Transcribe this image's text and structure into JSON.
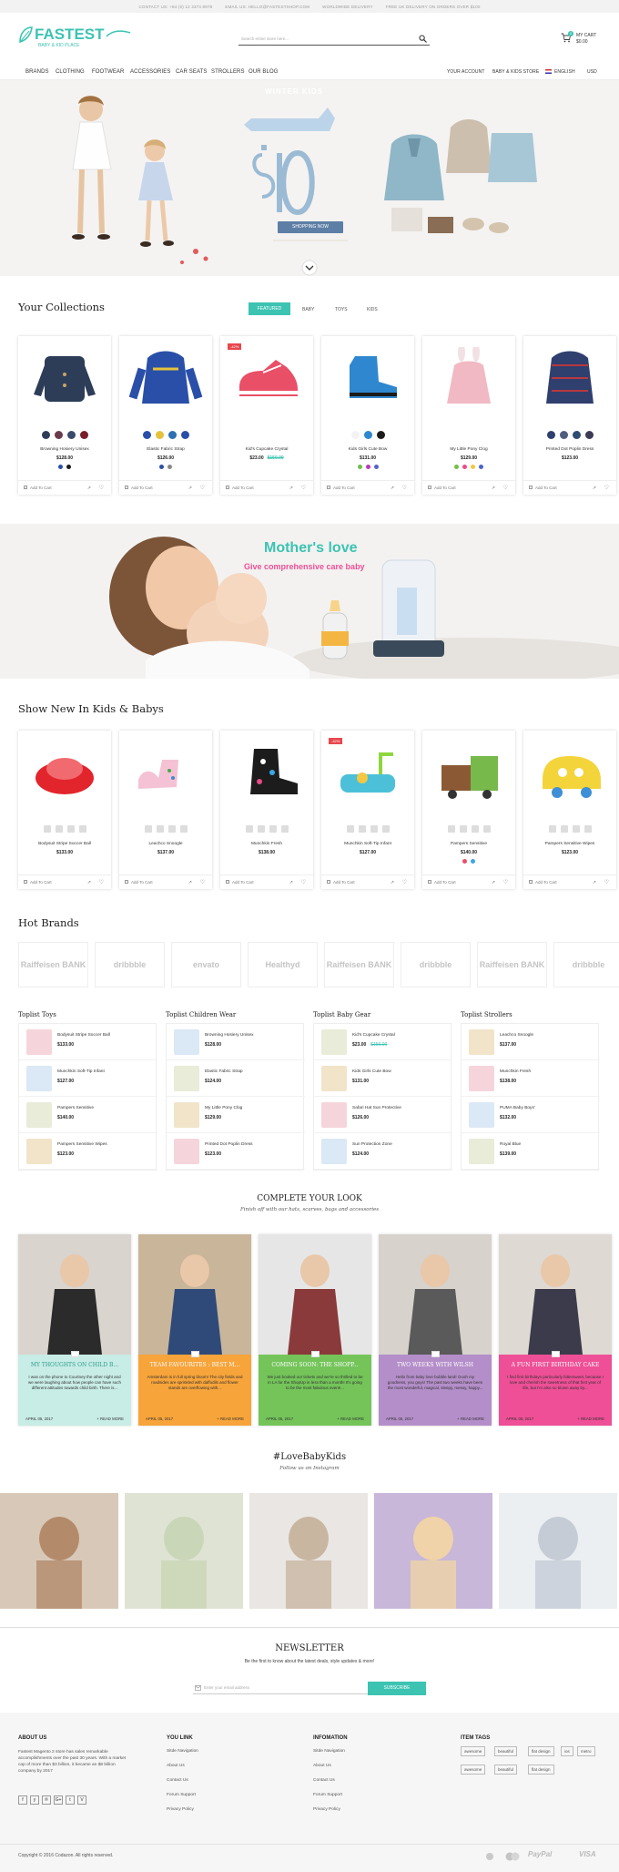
{
  "topbar": {
    "contact": "CONTACT US: +84 (0) 12 3374 8978",
    "email": "EMAIL US: HELLO@FASTESTSHOP.COM",
    "worldwide": "WORLDWIDE DELIVERY",
    "delivery": "FREE UK DELIVERY ON ORDERS OVER $100"
  },
  "header": {
    "logo_text": "FASTEST",
    "logo_sub": "BABY & KID PLACE",
    "search_placeholder": "Search entire store here...",
    "cart_label": "MY CART",
    "cart_total": "$0.00",
    "cart_count": "0"
  },
  "nav": {
    "items": [
      "BRANDS",
      "CLOTHING",
      "FOOTWEAR",
      "ACCESSORIES",
      "CAR SEATS",
      "STROLLERS",
      "OUR BLOG"
    ],
    "account": "YOUR ACCOUNT",
    "store": "BABY & KIDS STORE",
    "language": "ENGLISH",
    "currency": "USD"
  },
  "hero": {
    "badge": "WINTER KIDS",
    "price": "$10",
    "button": "SHOPPING NOW"
  },
  "collections": {
    "title": "Your Collections",
    "tabs": [
      "FEATURED",
      "BABY",
      "TOYS",
      "KIDS"
    ],
    "add_to_cart": "Add To Cart",
    "products": [
      {
        "name": "Browning Hosiery Unisex",
        "price": "$128.00",
        "old_price": "",
        "badge": ""
      },
      {
        "name": "Elastic Fabric Strap",
        "price": "$126.00",
        "old_price": "",
        "badge": ""
      },
      {
        "name": "Kid's Cupcake Crystal",
        "price": "$23.00",
        "old_price": "$150.00",
        "badge": "-42%"
      },
      {
        "name": "Kids Girls Cute Bow",
        "price": "$131.00",
        "old_price": "",
        "badge": ""
      },
      {
        "name": "My Little Pony Clog",
        "price": "$129.00",
        "old_price": "",
        "badge": ""
      },
      {
        "name": "Printed Dot Poplin Dress",
        "price": "$123.00",
        "old_price": "",
        "badge": ""
      }
    ]
  },
  "banner": {
    "title": "Mother's love",
    "subtitle": "Give comprehensive care baby"
  },
  "new_in": {
    "title": "Show New In Kids & Babys",
    "products": [
      {
        "name": "Bodysuit Stripe Soccer Ball",
        "price": "$133.00",
        "badge": ""
      },
      {
        "name": "Leachco Snoogle",
        "price": "$137.00",
        "badge": ""
      },
      {
        "name": "Munchkin Fresh",
        "price": "$138.00",
        "badge": ""
      },
      {
        "name": "Munchkin Soft-Tip Infant",
        "price": "$127.00",
        "badge": "-42%"
      },
      {
        "name": "Pampers Sensitive",
        "price": "$140.00",
        "badge": ""
      },
      {
        "name": "Pampers Sensitive Wipes",
        "price": "$123.00",
        "badge": ""
      }
    ]
  },
  "brands": {
    "title": "Hot Brands",
    "items": [
      "Raiffeisen BANK",
      "dribbble",
      "envato",
      "Healthyd",
      "Raiffeisen BANK",
      "dribbble",
      "Raiffeisen BANK",
      "dribbble"
    ]
  },
  "toplists": [
    {
      "title": "Toplist Toys",
      "items": [
        {
          "name": "Bodysuit Stripe Soccer Ball",
          "price": "$133.00",
          "old": ""
        },
        {
          "name": "Munchkin Soft-Tip Infant",
          "price": "$127.00",
          "old": ""
        },
        {
          "name": "Pampers Sensitive",
          "price": "$140.00",
          "old": ""
        },
        {
          "name": "Pampers Sensitive Wipes",
          "price": "$123.00",
          "old": ""
        }
      ]
    },
    {
      "title": "Toplist Children Wear",
      "items": [
        {
          "name": "Browning Hosiery Unisex",
          "price": "$128.00",
          "old": ""
        },
        {
          "name": "Elastic Fabric Strap",
          "price": "$124.00",
          "old": ""
        },
        {
          "name": "My Little Pony Clog",
          "price": "$129.00",
          "old": ""
        },
        {
          "name": "Printed Dot Poplin Dress",
          "price": "$123.00",
          "old": ""
        }
      ]
    },
    {
      "title": "Toplist Baby Gear",
      "items": [
        {
          "name": "Kid's Cupcake Crystal",
          "price": "$23.00",
          "old": "$150.00"
        },
        {
          "name": "Kids Girls Cute Bow",
          "price": "$131.00",
          "old": ""
        },
        {
          "name": "Safari Hat Sun Protective",
          "price": "$126.00",
          "old": ""
        },
        {
          "name": "Sun Protection Zone",
          "price": "$124.00",
          "old": ""
        }
      ]
    },
    {
      "title": "Toplist Strollers",
      "items": [
        {
          "name": "Leachco Snoogle",
          "price": "$137.00",
          "old": ""
        },
        {
          "name": "Munchkin Fresh",
          "price": "$138.00",
          "old": ""
        },
        {
          "name": "PUMA Baby Boys'",
          "price": "$132.00",
          "old": ""
        },
        {
          "name": "Royal Blue",
          "price": "$139.00",
          "old": ""
        }
      ]
    }
  ],
  "look": {
    "title": "COMPLETE YOUR LOOK",
    "subtitle": "Finish off with our hats, scarves, bags and accessories",
    "posts": [
      {
        "title": "MY THOUGHTS ON CHILD B...",
        "text": "I was on the phone to Courtney the other night and we were laughing about how people can have such different attitudes towards child birth. There is...",
        "date": "APRIL 05, 2017",
        "more": "+ READ MORE",
        "color": "#c8ece6"
      },
      {
        "title": "TEAM FAVOURITES : BEST M...",
        "text": "Amsterdam is in full spring bloom! The city fields and roadsides are sprinkled with daffodils and flower stands are overflowing with...",
        "date": "APRIL 05, 2017",
        "more": "+ READ MORE",
        "color": "#f7a43a"
      },
      {
        "title": "COMING SOON: THE SHOPP...",
        "text": "We just booked our tickets and we're so thrilled to be in LA for the ShopUp in less than a month! It's going to be the most fabulous event!...",
        "date": "APRIL 05, 2017",
        "more": "+ READ MORE",
        "color": "#74c45a"
      },
      {
        "title": "TWO WEEKS WITH WILSH",
        "text": "Hello from baby love bubble land! Oooh my goodness, you guys! The past two weeks have been the most wonderful, magical, sleepy, messy, happy...",
        "date": "APRIL 05, 2017",
        "more": "+ READ MORE",
        "color": "#b48ec9"
      },
      {
        "title": "A FUN FIRST BIRTHDAY CAKE",
        "text": "I find first birthdays particularly bittersweet, because I love and cherish the sweetness of that first year of life, but I'm also so blown away by...",
        "date": "APRIL 05, 2017",
        "more": "+ READ MORE",
        "color": "#ee4f96"
      }
    ]
  },
  "instagram": {
    "title": "#LoveBabyKids",
    "subtitle": "Follow us on Instagram"
  },
  "newsletter": {
    "title": "NEWSLETTER",
    "text": "Be the first to know about the latest deals, style updates & more!",
    "placeholder": "Enter your email address",
    "button": "SUBSCRIBE"
  },
  "footer": {
    "about_title": "ABOUT US",
    "about_text": "Fastest Magento 2 store has sales remarkable accomplishments over the past 30 years. With a market cap of more than $3 billion, it became an $8 billion company by 2017",
    "social": [
      "f",
      "y",
      "℗",
      "G+",
      "t",
      "V"
    ],
    "you_link_title": "YOU LINK",
    "you_links": [
      "Sitde Navigation",
      "About Us",
      "Contact Us",
      "Forum Support",
      "Privacy Policy"
    ],
    "info_title": "INFOMATION",
    "info_links": [
      "Sitde Navigation",
      "About Us",
      "Contact Us",
      "Forum Support",
      "Privacy Policy"
    ],
    "tags_title": "ITEM TAGS",
    "tags": [
      "awesome",
      "beautiful",
      "flat design",
      "ios",
      "metro",
      "awesome",
      "beautiful",
      "flat design"
    ],
    "copyright": "Copyright © 2016 Codazon. All rights reserved.",
    "payments": [
      "MasterCard",
      "PayPal",
      "VISA"
    ]
  }
}
